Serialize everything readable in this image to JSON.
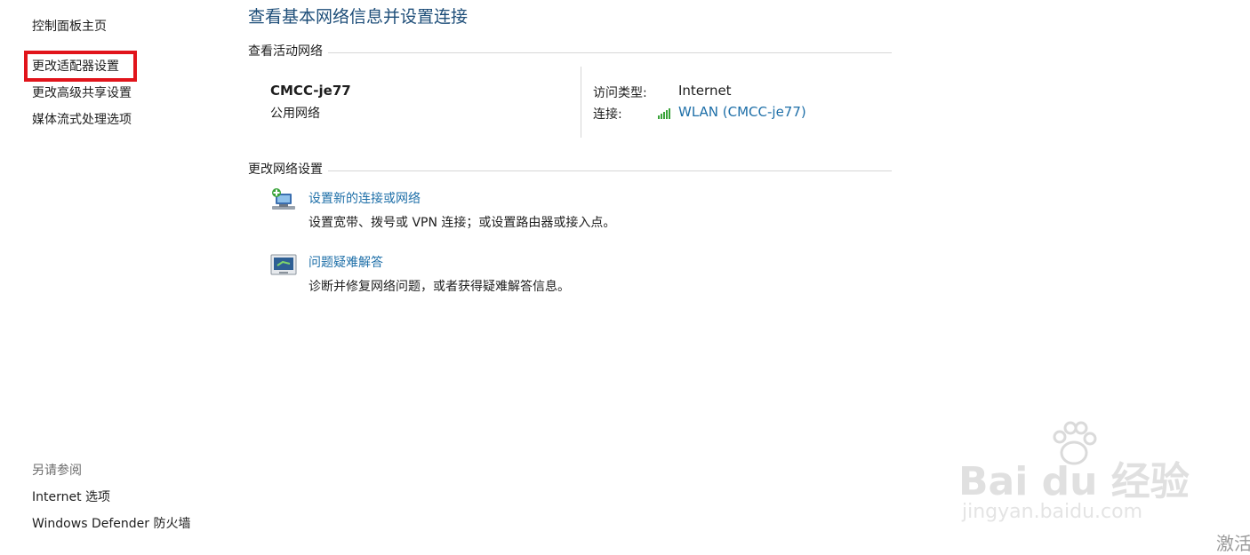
{
  "sidebar": {
    "home": "控制面板主页",
    "items": [
      {
        "label": "更改适配器设置"
      },
      {
        "label": "更改高级共享设置"
      },
      {
        "label": "媒体流式处理选项"
      }
    ],
    "see_also_title": "另请参阅",
    "see_also": [
      {
        "label": "Internet 选项"
      },
      {
        "label": "Windows Defender 防火墙"
      }
    ]
  },
  "main": {
    "title": "查看基本网络信息并设置连接",
    "active_section": "查看活动网络",
    "network": {
      "name": "CMCC-je77",
      "category": "公用网络",
      "access_type_label": "访问类型:",
      "access_type_value": "Internet",
      "connection_label": "连接:",
      "connection_value": "WLAN (CMCC-je77)"
    },
    "change_section": "更改网络设置",
    "tasks": [
      {
        "title": "设置新的连接或网络",
        "desc": "设置宽带、拨号或 VPN 连接；或设置路由器或接入点。"
      },
      {
        "title": "问题疑难解答",
        "desc": "诊断并修复网络问题，或者获得疑难解答信息。"
      }
    ]
  },
  "watermark": {
    "brand": "Bai du 经验",
    "url": "jingyan.baidu.com",
    "corner": "激活"
  },
  "colors": {
    "title": "#1e4e79",
    "link": "#1e6fa8",
    "highlight": "#e1141b",
    "signal": "#3aa33a"
  }
}
